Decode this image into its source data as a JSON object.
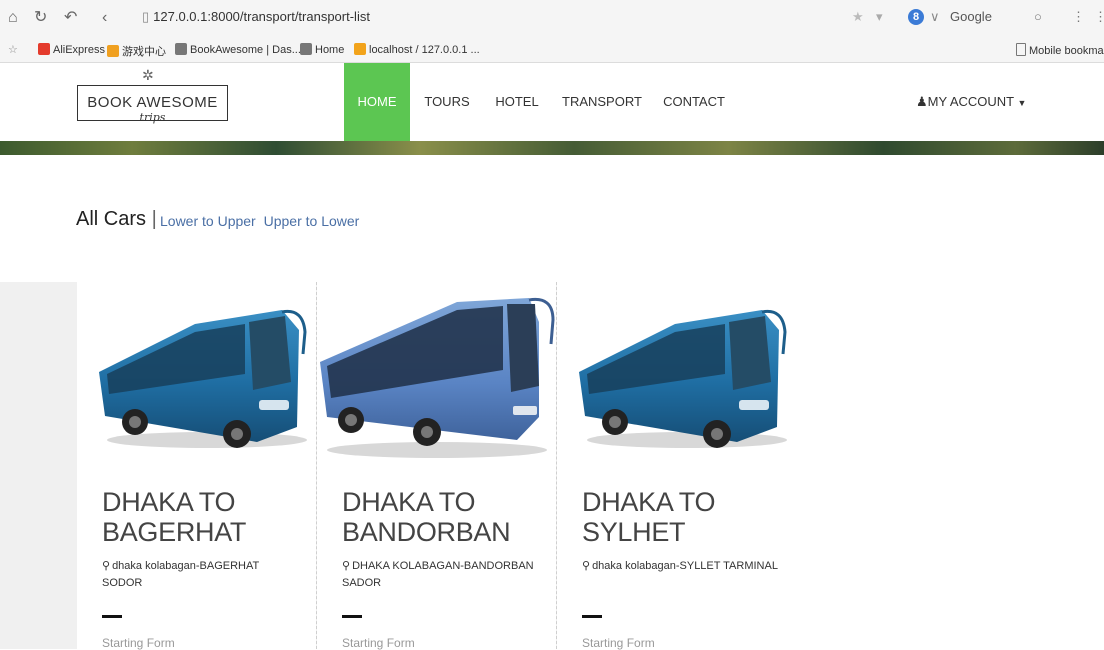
{
  "browser": {
    "url": "127.0.0.1:8000/transport/transport-list",
    "search_engine": "Google",
    "bookmarks": [
      "AliExpress",
      "游戏中心",
      "BookAwesome | Das...",
      "Home",
      "localhost / 127.0.0.1 ..."
    ],
    "mobile_bookmarks": "Mobile bookma"
  },
  "site": {
    "logo_main": "BOOK AWESOME",
    "logo_sub": "trips",
    "nav": [
      "HOME",
      "TOURS",
      "HOTEL",
      "TRANSPORT",
      "CONTACT"
    ],
    "active_nav": "HOME",
    "account": "MY ACCOUNT",
    "accent_color": "#5cc652"
  },
  "listing": {
    "title": "All Cars",
    "sort_low_high": "Lower to Upper",
    "sort_high_low": "Upper to Lower"
  },
  "cards": [
    {
      "title_line1": "DHAKA TO",
      "title_line2": "BAGERHAT",
      "location": "dhaka kolabagan-BAGERHAT SODOR",
      "from_label": "Starting Form"
    },
    {
      "title_line1": "DHAKA TO",
      "title_line2": "BANDORBAN",
      "location": "DHAKA KOLABAGAN-BANDORBAN SADOR",
      "from_label": "Starting Form"
    },
    {
      "title_line1": "DHAKA TO",
      "title_line2": "SYLHET",
      "location": "dhaka kolabagan-SYLLET TARMINAL",
      "from_label": "Starting Form"
    }
  ]
}
